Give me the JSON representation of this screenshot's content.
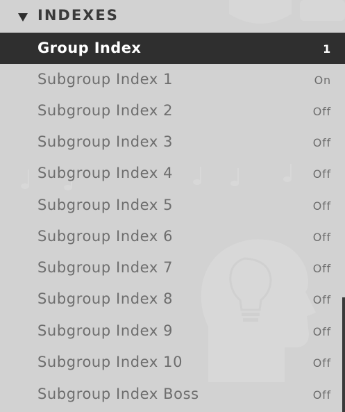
{
  "section": {
    "title": "INDEXES",
    "collapse_icon": "triangle-down-icon"
  },
  "rows": [
    {
      "label": "Group Index",
      "value": "1",
      "selected": true
    },
    {
      "label": "Subgroup Index 1",
      "value": "On",
      "selected": false
    },
    {
      "label": "Subgroup Index 2",
      "value": "Off",
      "selected": false
    },
    {
      "label": "Subgroup Index 3",
      "value": "Off",
      "selected": false
    },
    {
      "label": "Subgroup Index 4",
      "value": "Off",
      "selected": false
    },
    {
      "label": "Subgroup Index 5",
      "value": "Off",
      "selected": false
    },
    {
      "label": "Subgroup Index 6",
      "value": "Off",
      "selected": false
    },
    {
      "label": "Subgroup Index 7",
      "value": "Off",
      "selected": false
    },
    {
      "label": "Subgroup Index 8",
      "value": "Off",
      "selected": false
    },
    {
      "label": "Subgroup Index 9",
      "value": "Off",
      "selected": false
    },
    {
      "label": "Subgroup Index 10",
      "value": "Off",
      "selected": false
    },
    {
      "label": "Subgroup Index Boss",
      "value": "Off",
      "selected": false
    }
  ],
  "colors": {
    "background": "#d2d2d2",
    "selected_row": "#2f2f2f",
    "selected_text": "#ffffff",
    "text": "#6e6e6e",
    "header_text": "#3a3a3a"
  }
}
